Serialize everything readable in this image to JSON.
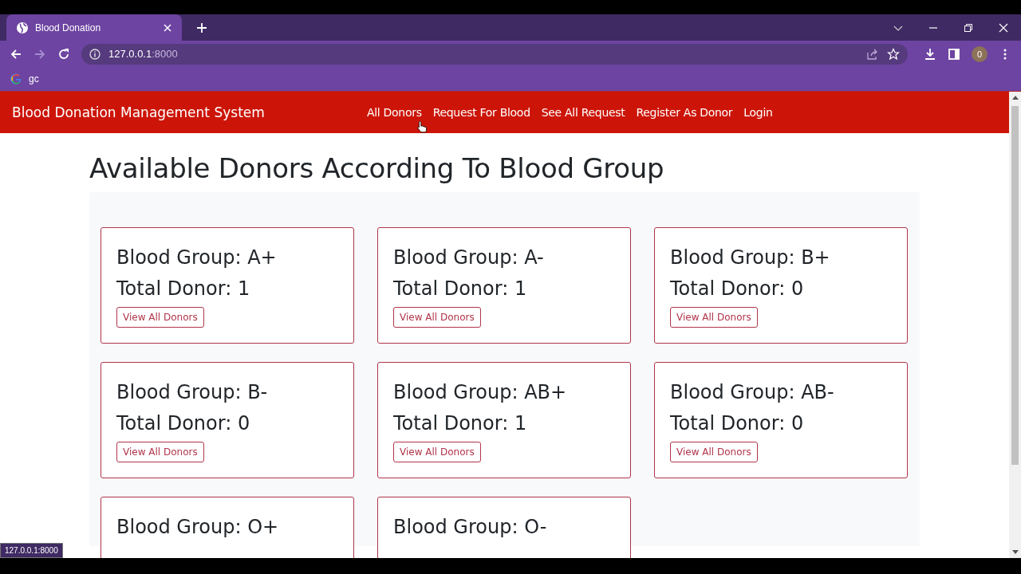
{
  "browser": {
    "tab_title": "Blood Donation",
    "address": {
      "host": "127.0.0.1",
      "port": ":8000"
    },
    "bookmarks": [
      {
        "label": "gc"
      }
    ],
    "profile_initial": "0",
    "status_url": "127.0.0.1:8000"
  },
  "navbar": {
    "brand": "Blood Donation Management System",
    "links": [
      "All Donors",
      "Request For Blood",
      "See All Request",
      "Register As Donor",
      "Login"
    ]
  },
  "heading": "Available Donors According To Blood Group",
  "cards": [
    {
      "group": "Blood Group: A+",
      "total": "Total Donor: 1",
      "button": "View All Donors"
    },
    {
      "group": "Blood Group: A-",
      "total": "Total Donor: 1",
      "button": "View All Donors"
    },
    {
      "group": "Blood Group: B+",
      "total": "Total Donor: 0",
      "button": "View All Donors"
    },
    {
      "group": "Blood Group: B-",
      "total": "Total Donor: 0",
      "button": "View All Donors"
    },
    {
      "group": "Blood Group: AB+",
      "total": "Total Donor: 1",
      "button": "View All Donors"
    },
    {
      "group": "Blood Group: AB-",
      "total": "Total Donor: 0",
      "button": "View All Donors"
    },
    {
      "group": "Blood Group: O+"
    },
    {
      "group": "Blood Group: O-"
    }
  ]
}
